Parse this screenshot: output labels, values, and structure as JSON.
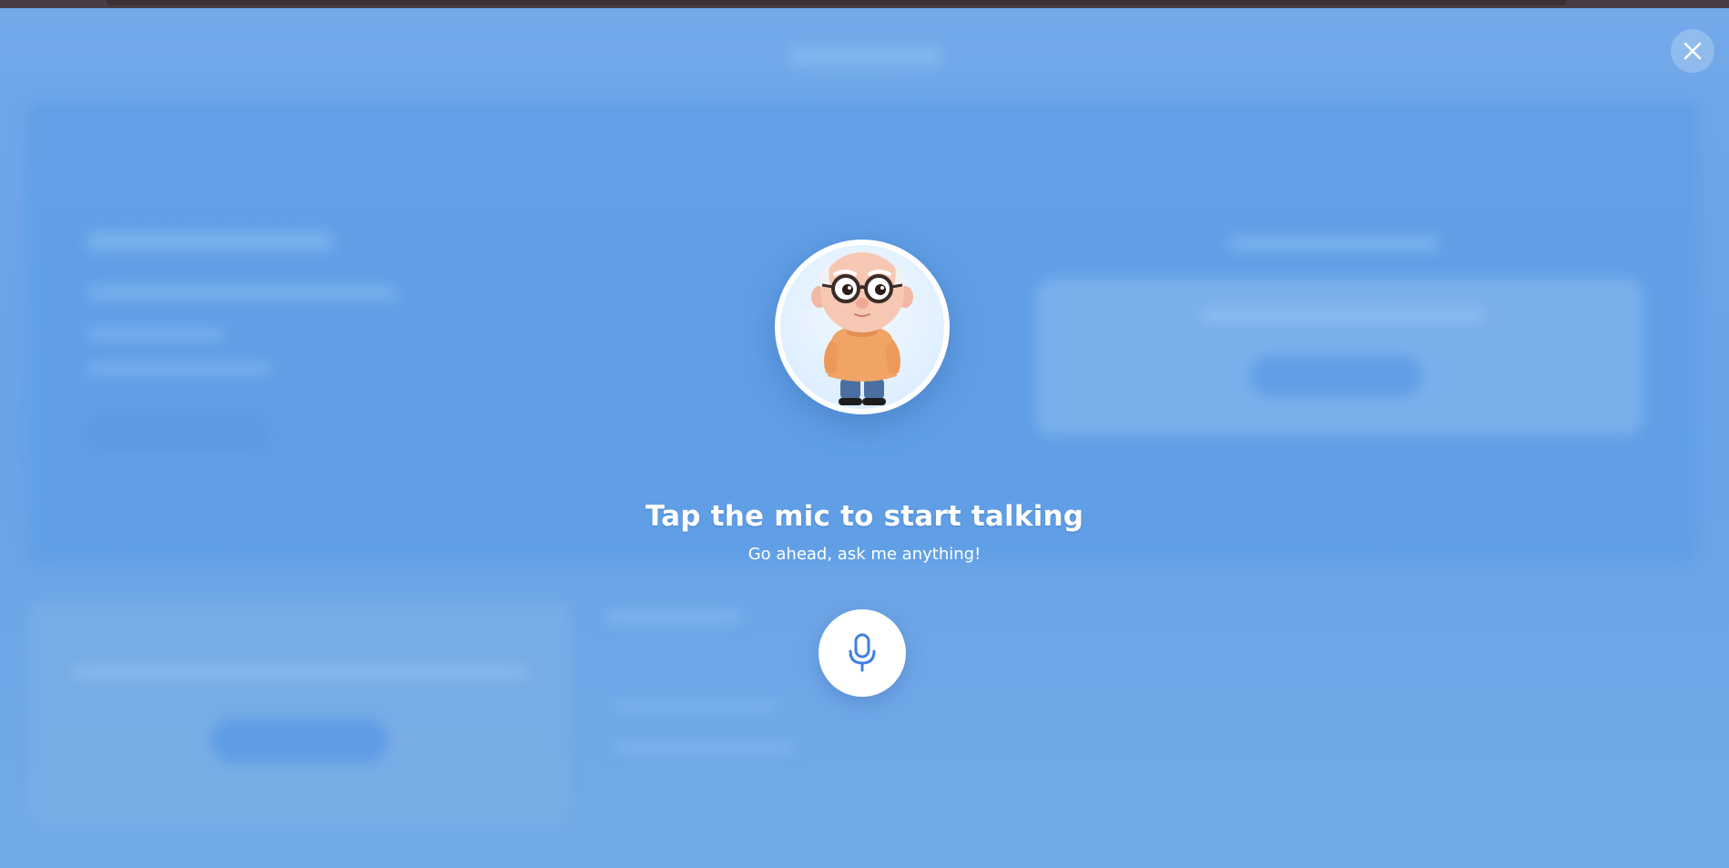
{
  "overlay": {
    "title": "Tap the mic to start talking",
    "subtitle": "Go ahead, ask me anything!"
  },
  "icons": {
    "close": "close-icon",
    "mic": "microphone-icon",
    "avatar": "character-avatar"
  },
  "colors": {
    "backdrop": "#6fa7e6",
    "mic_icon": "#3f7fe0",
    "text": "#ffffff"
  }
}
